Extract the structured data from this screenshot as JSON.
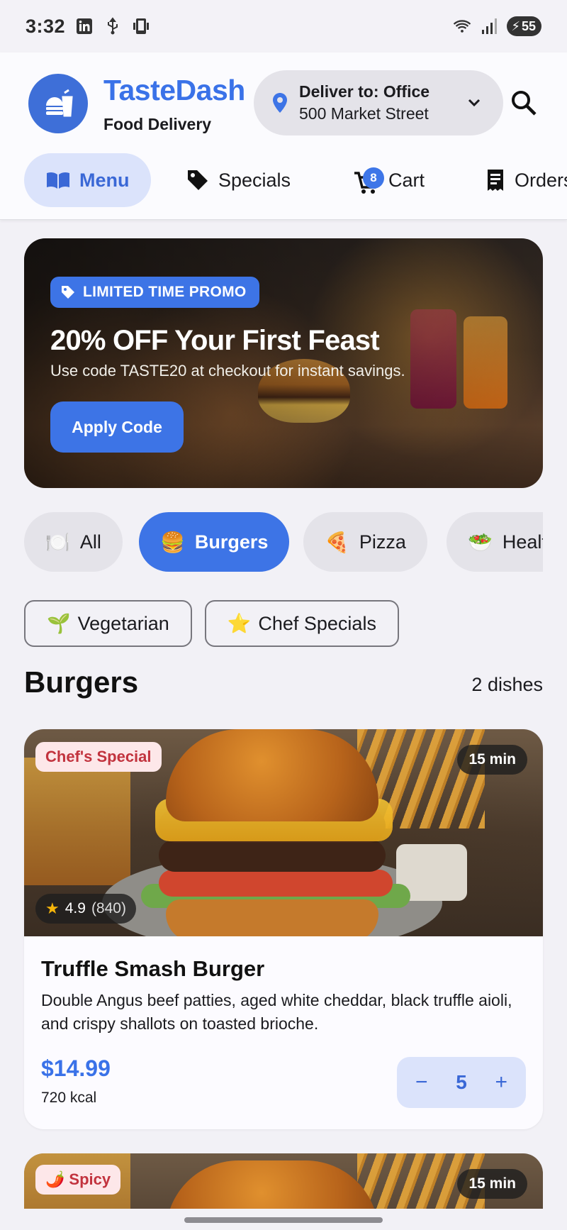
{
  "status_bar": {
    "time": "3:32",
    "battery": "55"
  },
  "brand": {
    "name": "TasteDash",
    "subtitle": "Food Delivery"
  },
  "delivery": {
    "label": "Deliver to: Office",
    "address": "500 Market Street"
  },
  "nav": {
    "items": [
      {
        "label": "Menu",
        "icon": "book-icon",
        "active": true
      },
      {
        "label": "Specials",
        "icon": "tag-icon"
      },
      {
        "label": "Cart",
        "icon": "cart-icon",
        "badge": "8"
      },
      {
        "label": "Orders",
        "icon": "receipt-icon"
      }
    ]
  },
  "promo": {
    "tag": "LIMITED TIME PROMO",
    "title": "20% OFF Your First Feast",
    "subtitle": "Use code TASTE20 at checkout for instant savings.",
    "button": "Apply Code"
  },
  "categories": [
    {
      "emoji": "🍽️",
      "label": "All"
    },
    {
      "emoji": "🍔",
      "label": "Burgers",
      "active": true
    },
    {
      "emoji": "🍕",
      "label": "Pizza"
    },
    {
      "emoji": "🥗",
      "label": "Healthy"
    }
  ],
  "filters": [
    {
      "emoji": "🌱",
      "label": "Vegetarian"
    },
    {
      "emoji": "⭐",
      "label": "Chef Specials"
    }
  ],
  "section": {
    "title": "Burgers",
    "count": "2 dishes"
  },
  "dishes": [
    {
      "badge": "Chef's Special",
      "time": "15 min",
      "rating": "4.9",
      "reviews": "(840)",
      "name": "Truffle Smash Burger",
      "description": "Double Angus beef patties, aged white cheddar, black truffle aioli, and crispy shallots on toasted brioche.",
      "price": "$14.99",
      "kcal": "720 kcal",
      "quantity": "5",
      "minus": "−",
      "plus": "+"
    },
    {
      "badge_emoji": "🌶️",
      "badge": "Spicy",
      "time": "15 min"
    }
  ],
  "colors": {
    "accent": "#3d74e6",
    "brand": "#3a72e8",
    "badge_red": "#c2333e",
    "chip_bg": "#e4e3e9"
  }
}
